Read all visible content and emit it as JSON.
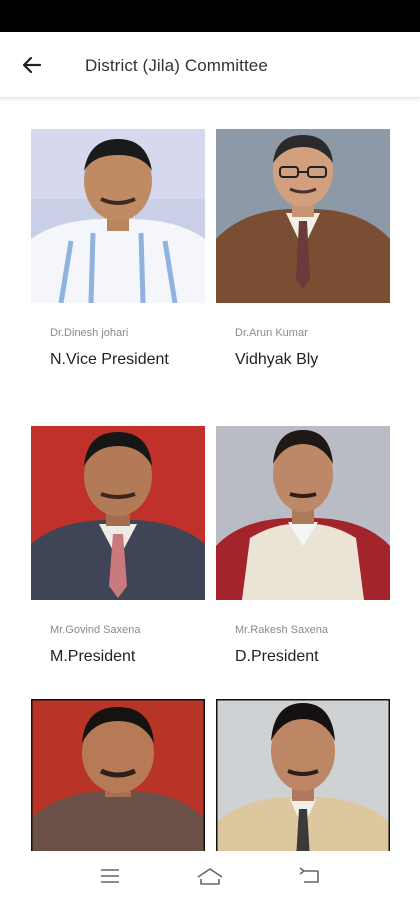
{
  "header": {
    "title": "District (Jila) Committee",
    "back_icon": "arrow-left-icon"
  },
  "members": [
    {
      "name": "Dr.Dinesh johari",
      "role": "N.Vice President"
    },
    {
      "name": "Dr.Arun Kumar",
      "role": "Vidhyak Bly"
    },
    {
      "name": "Mr.Govind Saxena",
      "role": "M.President"
    },
    {
      "name": "Mr.Rakesh Saxena",
      "role": "D.President"
    },
    {
      "name": "",
      "role": ""
    },
    {
      "name": "",
      "role": ""
    }
  ],
  "nav": {
    "menu_icon": "menu-icon",
    "home_icon": "home-icon",
    "back_icon": "back-icon"
  },
  "colors": {
    "status_bar": "#000000",
    "title_text": "#333333",
    "name_text": "#8a8a8a",
    "role_text": "#222222"
  }
}
